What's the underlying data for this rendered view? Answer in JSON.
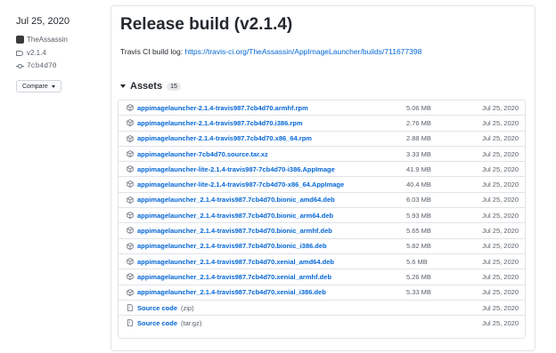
{
  "sidebar": {
    "date": "Jul 25, 2020",
    "author": "TheAssassin",
    "tag": "v2.1.4",
    "commit": "7cb4d70",
    "compare_label": "Compare"
  },
  "release": {
    "title": "Release build (v2.1.4)",
    "build_log_prefix": "Travis CI build log:",
    "build_log_url": "https://travis-ci.org/TheAssassin/AppImageLauncher/builds/711677398"
  },
  "assets": {
    "label": "Assets",
    "count": "15",
    "items": [
      {
        "name": "appimagelauncher-2.1.4-travis987.7cb4d70.armhf.rpm",
        "size": "5.06 MB",
        "date": "Jul 25, 2020"
      },
      {
        "name": "appimagelauncher-2.1.4-travis987.7cb4d70.i386.rpm",
        "size": "2.76 MB",
        "date": "Jul 25, 2020"
      },
      {
        "name": "appimagelauncher-2.1.4-travis987.7cb4d70.x86_64.rpm",
        "size": "2.88 MB",
        "date": "Jul 25, 2020"
      },
      {
        "name": "appimagelauncher-7cb4d70.source.tar.xz",
        "size": "3.33 MB",
        "date": "Jul 25, 2020"
      },
      {
        "name": "appimagelauncher-lite-2.1.4-travis987-7cb4d70-i386.AppImage",
        "size": "41.9 MB",
        "date": "Jul 25, 2020"
      },
      {
        "name": "appimagelauncher-lite-2.1.4-travis987-7cb4d70-x86_64.AppImage",
        "size": "40.4 MB",
        "date": "Jul 25, 2020"
      },
      {
        "name": "appimagelauncher_2.1.4-travis987.7cb4d70.bionic_amd64.deb",
        "size": "6.03 MB",
        "date": "Jul 25, 2020"
      },
      {
        "name": "appimagelauncher_2.1.4-travis987.7cb4d70.bionic_arm64.deb",
        "size": "5.93 MB",
        "date": "Jul 25, 2020"
      },
      {
        "name": "appimagelauncher_2.1.4-travis987.7cb4d70.bionic_armhf.deb",
        "size": "5.65 MB",
        "date": "Jul 25, 2020"
      },
      {
        "name": "appimagelauncher_2.1.4-travis987.7cb4d70.bionic_i386.deb",
        "size": "5.82 MB",
        "date": "Jul 25, 2020"
      },
      {
        "name": "appimagelauncher_2.1.4-travis987.7cb4d70.xenial_amd64.deb",
        "size": "5.6 MB",
        "date": "Jul 25, 2020"
      },
      {
        "name": "appimagelauncher_2.1.4-travis987.7cb4d70.xenial_armhf.deb",
        "size": "5.26 MB",
        "date": "Jul 25, 2020"
      },
      {
        "name": "appimagelauncher_2.1.4-travis987.7cb4d70.xenial_i386.deb",
        "size": "5.33 MB",
        "date": "Jul 25, 2020"
      }
    ],
    "source": [
      {
        "label": "Source code",
        "format": "(zip)",
        "date": "Jul 25, 2020"
      },
      {
        "label": "Source code",
        "format": "(tar.gz)",
        "date": "Jul 25, 2020"
      }
    ]
  }
}
